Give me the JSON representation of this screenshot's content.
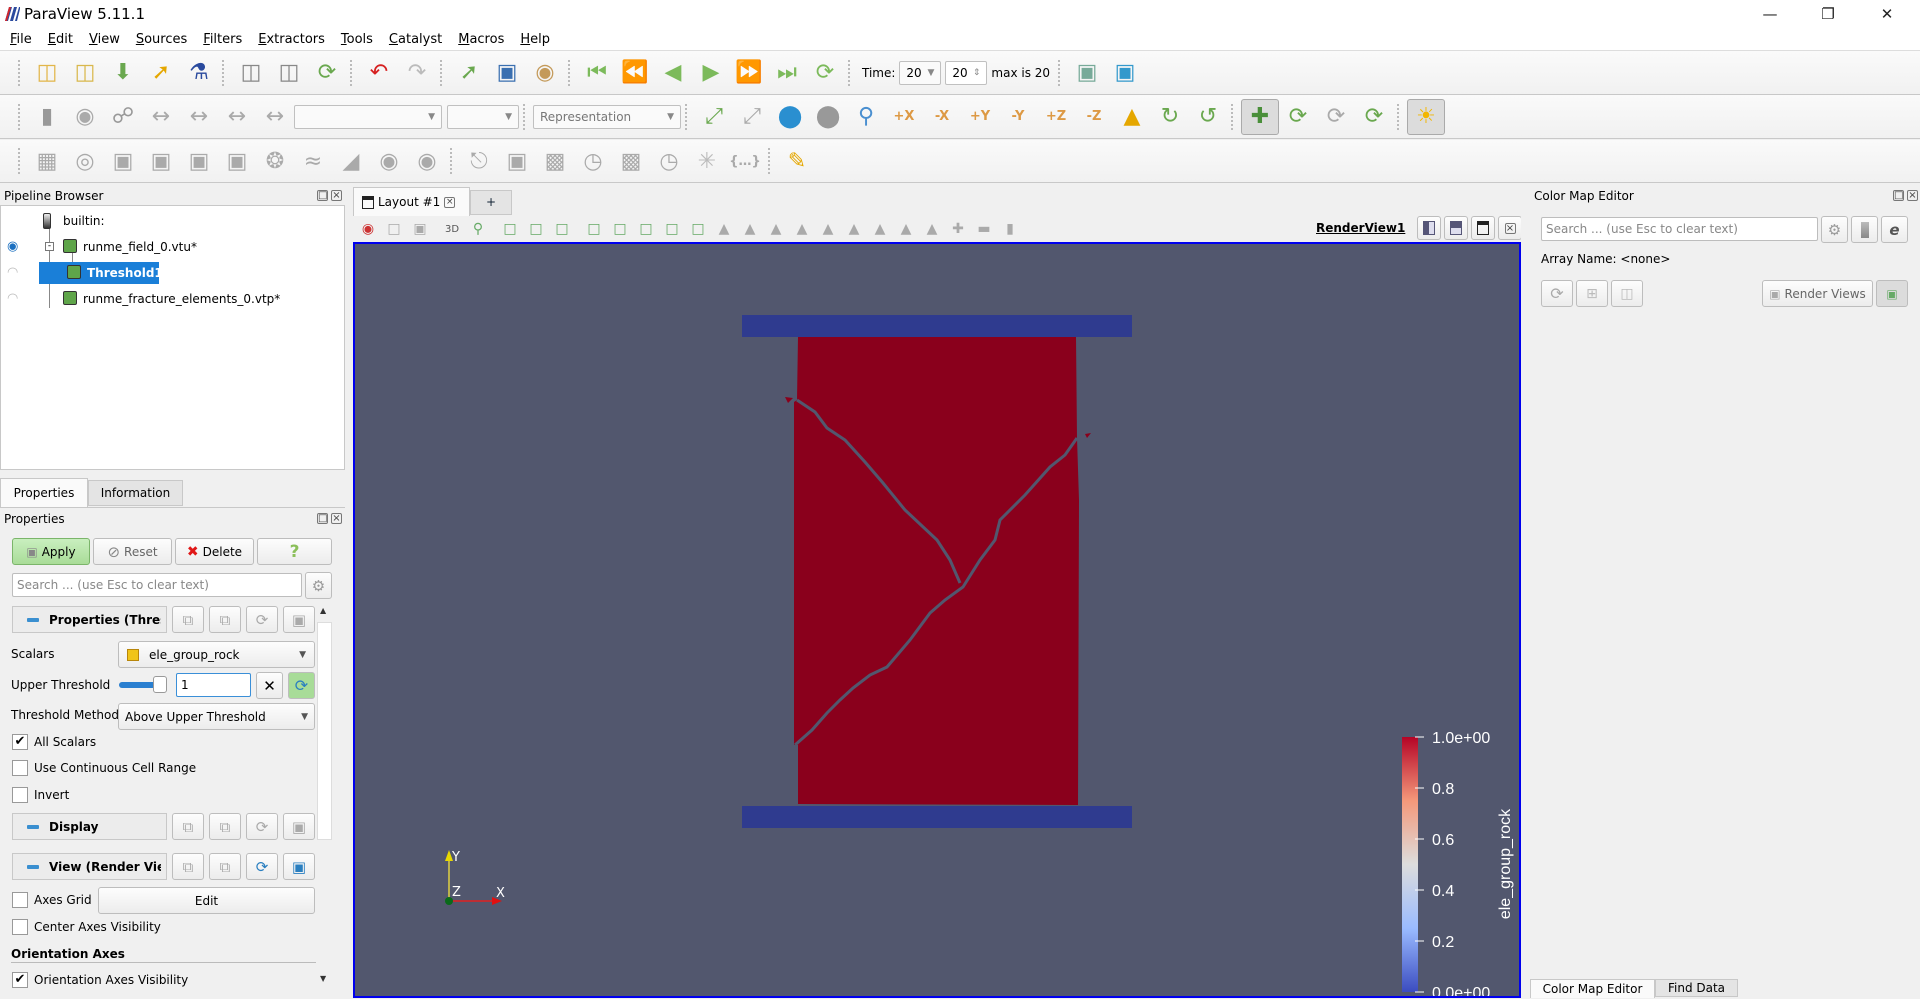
{
  "app": {
    "title": "ParaView 5.11.1",
    "window_controls": [
      "minimize",
      "restore",
      "close"
    ]
  },
  "menu": [
    "File",
    "Edit",
    "View",
    "Sources",
    "Filters",
    "Extractors",
    "Tools",
    "Catalyst",
    "Macros",
    "Help"
  ],
  "toolbar1": {
    "groups": [
      [
        "open-icon",
        "load-state-icon",
        "save-data-icon",
        "save-state-icon",
        "paraview-logo-icon"
      ],
      [
        "connect-icon",
        "disconnect-icon",
        "auto-apply-icon"
      ],
      [
        "undo-icon",
        "redo-icon"
      ],
      [
        "python-trace-icon",
        "save-screenshot-icon",
        "color-palette-icon"
      ],
      [
        "first-frame-icon",
        "previous-frame-icon",
        "play-backward-icon",
        "play-icon",
        "next-frame-icon",
        "last-frame-icon",
        "loop-icon"
      ]
    ],
    "time_label": "Time:",
    "time_value": "20",
    "time_index": "20",
    "max_label": "max is 20",
    "camera": [
      "camera-link-icon",
      "camera-add-icon"
    ]
  },
  "toolbar2": {
    "groups": [
      [
        "color-legend-icon",
        "color-preset-icon",
        "edit-colormap-icon",
        "rescale-range-icon",
        "rescale-custom-icon",
        "rescale-temporal-icon",
        "rescale-visible-icon"
      ]
    ],
    "combo1": "",
    "combo2": "",
    "representation": "Representation",
    "camera": [
      [
        "reset-camera-icon",
        "zoom-to-data-icon",
        "reset-closest-icon",
        "zoom-closest-icon",
        "zoom-to-box-icon",
        "view-plus-x-icon",
        "view-minus-x-icon",
        "view-plus-y-icon",
        "view-minus-y-icon",
        "view-plus-z-icon",
        "view-minus-z-icon",
        "isometric-view-icon",
        "rotate-plus-90-icon",
        "rotate-minus-90-icon"
      ],
      [
        "show-center-icon",
        "pick-center-icon",
        "reset-center-icon",
        "interaction-mode-icon"
      ],
      [
        "light-kit-icon"
      ]
    ],
    "active": [
      "show-center-icon",
      "light-kit-icon"
    ]
  },
  "toolbar3": {
    "groups": [
      [
        "calculator-icon",
        "contour-icon",
        "clip-icon",
        "slice-icon",
        "threshold-icon",
        "extract-subset-icon",
        "glyph-icon",
        "stream-tracer-icon",
        "warp-vector-icon",
        "group-datasets-icon",
        "extract-level-icon"
      ],
      [
        "probe-line-icon",
        "plot-over-line-icon",
        "histogram-icon",
        "plot-time-icon",
        "plot-data-icon",
        "plot-selection-icon",
        "find-data-icon",
        "python-calculator-icon"
      ],
      [
        "ruler-icon"
      ]
    ]
  },
  "pipeline": {
    "title": "Pipeline Browser",
    "items": [
      {
        "label": "builtin:",
        "visible": null
      },
      {
        "label": "runme_field_0.vtu*",
        "visible": true
      },
      {
        "label": "Threshold1",
        "visible": false,
        "selected": true
      },
      {
        "label": "runme_fracture_elements_0.vtp*",
        "visible": false
      }
    ]
  },
  "left_tabs": [
    "Properties",
    "Information"
  ],
  "properties": {
    "title": "Properties",
    "apply": "Apply",
    "reset": "Reset",
    "delete": "Delete",
    "help": "?",
    "search_placeholder": "Search ... (use Esc to clear text)",
    "group_props": "Properties (Thres",
    "scalars_label": "Scalars",
    "scalars_value": "ele_group_rock",
    "upper_label": "Upper Threshold",
    "upper_value": "1",
    "upper_slider": 1.0,
    "method_label": "Threshold Method",
    "method_value": "Above Upper Threshold",
    "all_scalars": {
      "label": "All Scalars",
      "checked": true
    },
    "continuous": {
      "label": "Use Continuous Cell Range",
      "checked": false
    },
    "invert": {
      "label": "Invert",
      "checked": false
    },
    "group_display": "Display",
    "group_view": "View (Render Vie",
    "axes_grid": {
      "label": "Axes Grid",
      "checked": false
    },
    "edit": "Edit",
    "center_axes": {
      "label": "Center Axes Visibility",
      "checked": false
    },
    "orientation_header": "Orientation Axes",
    "orientation_vis": {
      "label": "Orientation Axes Visibility",
      "checked": true
    }
  },
  "layout": {
    "tab": "Layout #1",
    "add": "+",
    "view_name": "RenderView1",
    "toggle_3d": "3D"
  },
  "render": {
    "background": "#52576e",
    "plate_color": "#2f3b8f",
    "rock_color": "#8a001c",
    "axes": {
      "x": "X",
      "y": "Y",
      "z": "Z"
    },
    "colorbar": {
      "title": "ele_group_rock",
      "ticks": [
        "1.0e+00",
        "0.8",
        "0.6",
        "0.4",
        "0.2",
        "0.0e+00"
      ],
      "range": [
        0,
        1
      ],
      "colors": [
        "#b40426",
        "#f4987a",
        "#dddddd",
        "#9abbff",
        "#3b4cc0"
      ]
    }
  },
  "colormap": {
    "title": "Color Map Editor",
    "search_placeholder": "Search ... (use Esc to clear text)",
    "array_name": "Array Name: <none>",
    "render_views": "Render Views"
  },
  "right_tabs": [
    "Color Map Editor",
    "Find Data"
  ]
}
